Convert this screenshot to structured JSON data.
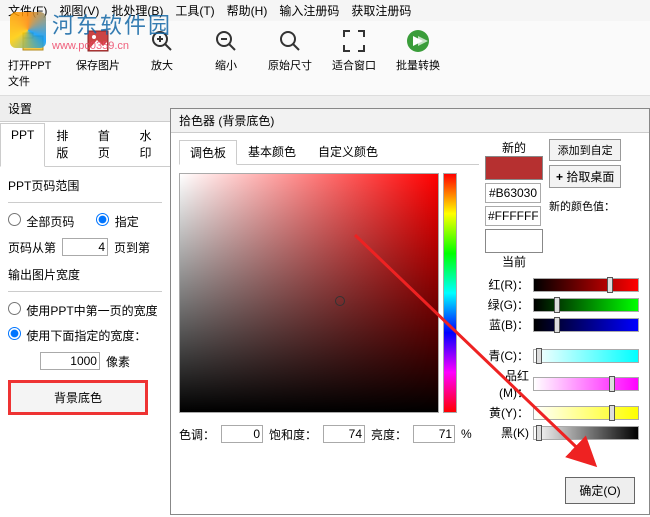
{
  "menu": {
    "file": "文件(F)",
    "view": "视图(V)",
    "batch": "批处理(B)",
    "tool": "工具(T)",
    "help": "帮助(H)",
    "enter_reg": "输入注册码",
    "get_reg": "获取注册码"
  },
  "toolbar": {
    "open": "打开PPT文件",
    "save": "保存图片",
    "zoom_in": "放大",
    "zoom_out": "缩小",
    "original": "原始尺寸",
    "fit": "适合窗口",
    "batch": "批量转换"
  },
  "settings_label": "设置",
  "left_tabs": {
    "ppt": "PPT",
    "layout": "排版",
    "home": "首页",
    "watermark": "水印"
  },
  "page_range": {
    "title": "PPT页码范围",
    "all": "全部页码",
    "specify": "指定",
    "from_label": "页码从第",
    "from_value": "4",
    "to_label": "页到第"
  },
  "output_width": {
    "title": "输出图片宽度",
    "use_first": "使用PPT中第一页的宽度",
    "use_specified": "使用下面指定的宽度：",
    "value": "1000",
    "unit": "像素"
  },
  "bg_button": "背景底色",
  "picker": {
    "title": "拾色器 (背景底色)",
    "tabs": {
      "palette": "调色板",
      "basic": "基本颜色",
      "custom": "自定义颜色"
    },
    "hsv": {
      "hue_label": "色调：",
      "hue": "0",
      "sat_label": "饱和度：",
      "sat": "74",
      "light_label": "亮度：",
      "light": "71",
      "pct": "%"
    },
    "new_label": "新的",
    "hex_new": "#B63030",
    "hex_cur": "#FFFFFF",
    "cur_label": "当前",
    "add_custom": "添加到自定",
    "pick_screen": "拾取桌面",
    "new_color_value": "新的颜色值：",
    "ch": {
      "r": "红(R)：",
      "g": "绿(G)：",
      "b": "蓝(B)：",
      "c": "青(C)：",
      "m": "品红(M)：",
      "y": "黄(Y)：",
      "k": "黑(K)"
    },
    "ok": "确定(O)"
  },
  "watermark": {
    "text": "河东软件园",
    "url": "www.pc0359.cn"
  }
}
